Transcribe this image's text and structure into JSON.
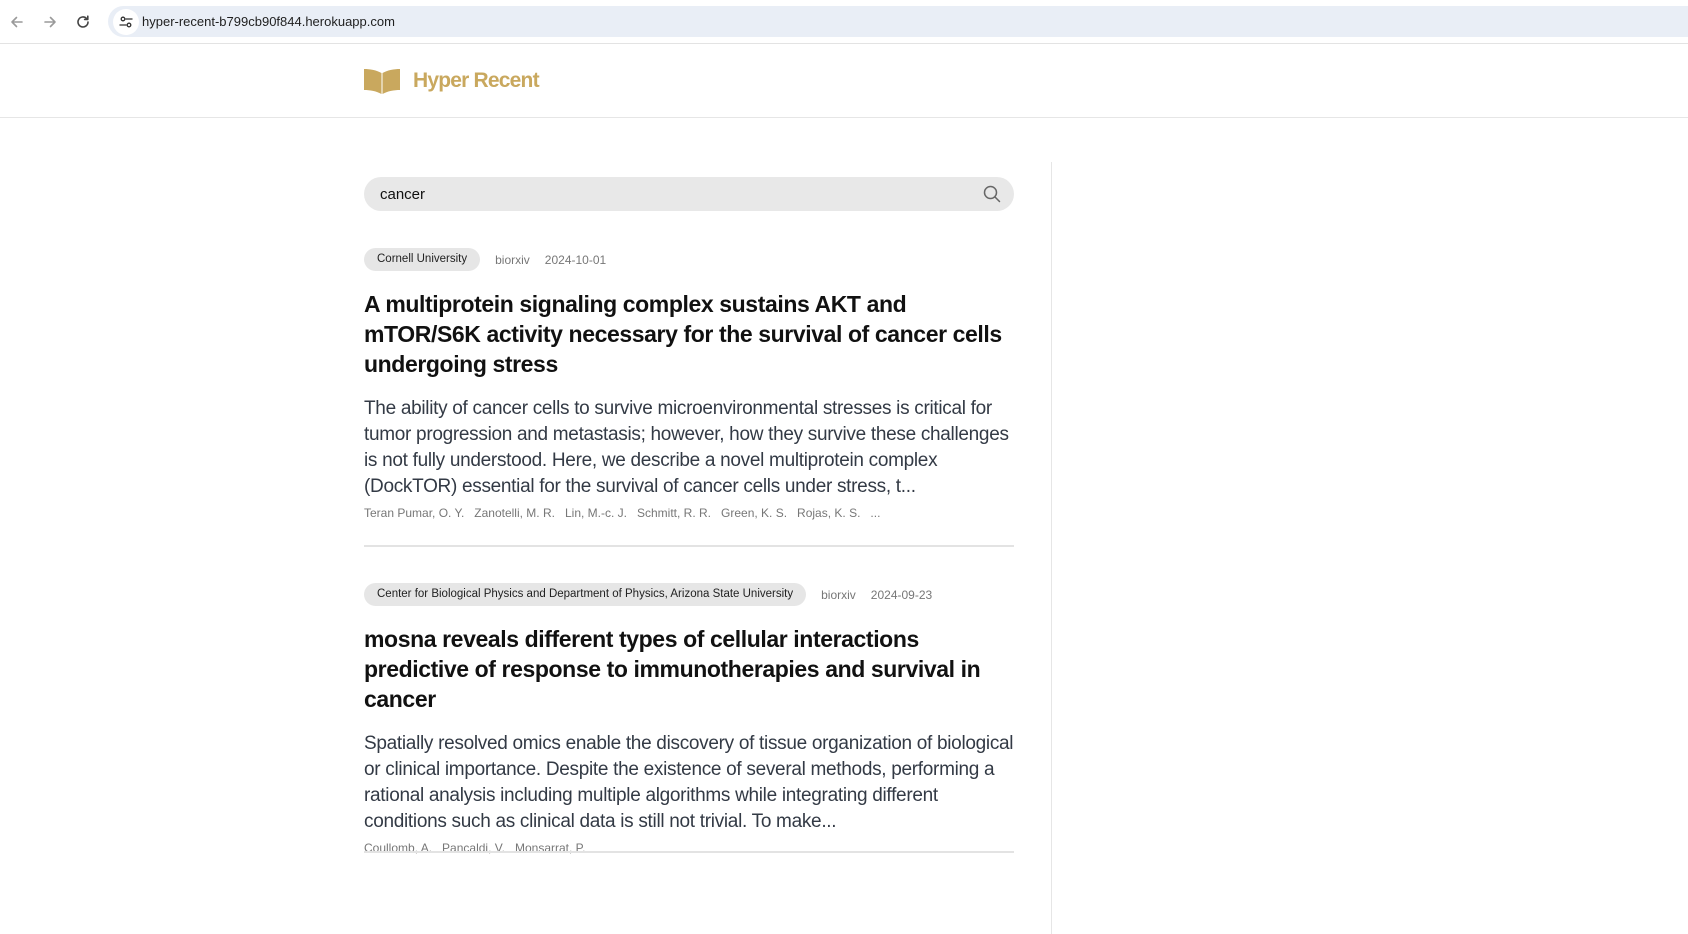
{
  "browser": {
    "url": "hyper-recent-b799cb90f844.herokuapp.com"
  },
  "site": {
    "name": "Hyper Recent",
    "brand_color": "#c9a85e"
  },
  "search": {
    "value": "cancer",
    "icon": "search-icon"
  },
  "articles": [
    {
      "affiliation": "Cornell University",
      "source": "biorxiv",
      "date": "2024-10-01",
      "title": "A multiprotein signaling complex sustains AKT and mTOR/S6K activity necessary for the survival of cancer cells undergoing stress",
      "abstract": "The ability of cancer cells to survive microenvironmental stresses is critical for tumor progression and metastasis; however, how they survive these challenges is not fully understood. Here, we describe a novel multiprotein complex (DockTOR) essential for the survival of cancer cells under stress, t...",
      "authors": [
        "Teran Pumar, O. Y.",
        "Zanotelli, M. R.",
        "Lin, M.-c. J.",
        "Schmitt, R. R.",
        "Green, K. S.",
        "Rojas, K. S.",
        "..."
      ]
    },
    {
      "affiliation": "Center for Biological Physics and Department of Physics, Arizona State University",
      "source": "biorxiv",
      "date": "2024-09-23",
      "title": "mosna reveals different types of cellular interactions predictive of response to immunotherapies and survival in cancer",
      "abstract": "Spatially resolved omics enable the discovery of tissue organization of biological or clinical importance. Despite the existence of several methods, performing a rational analysis including multiple algorithms while integrating different conditions such as clinical data is still not trivial. To make...",
      "authors": [
        "Coullomb, A.",
        "Pancaldi, V.",
        "Monsarrat, P."
      ]
    }
  ]
}
